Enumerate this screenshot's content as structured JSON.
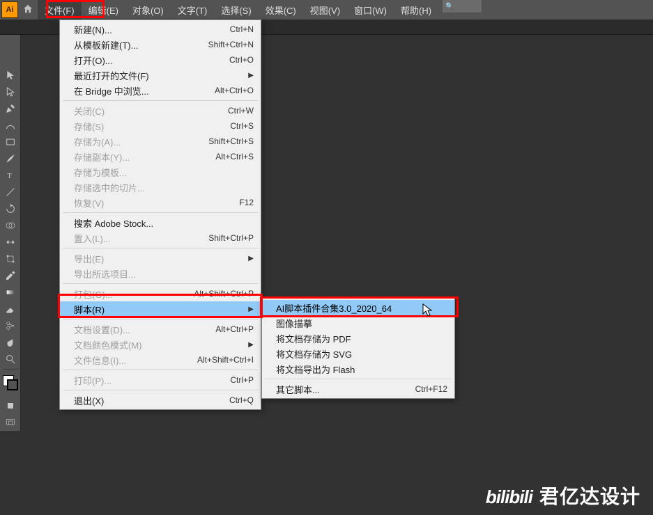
{
  "app": {
    "icon_text": "Ai",
    "search_placeholder": "搜索"
  },
  "menubar": [
    "文件(F)",
    "编辑(E)",
    "对象(O)",
    "文字(T)",
    "选择(S)",
    "效果(C)",
    "视图(V)",
    "窗口(W)",
    "帮助(H)"
  ],
  "file_menu": {
    "items": [
      {
        "label": "新建(N)...",
        "shortcut": "Ctrl+N"
      },
      {
        "label": "从模板新建(T)...",
        "shortcut": "Shift+Ctrl+N"
      },
      {
        "label": "打开(O)...",
        "shortcut": "Ctrl+O"
      },
      {
        "label": "最近打开的文件(F)",
        "arrow": true
      },
      {
        "label": "在 Bridge 中浏览...",
        "shortcut": "Alt+Ctrl+O"
      },
      {
        "sep": true
      },
      {
        "label": "关闭(C)",
        "shortcut": "Ctrl+W",
        "disabled": true
      },
      {
        "label": "存储(S)",
        "shortcut": "Ctrl+S",
        "disabled": true
      },
      {
        "label": "存储为(A)...",
        "shortcut": "Shift+Ctrl+S",
        "disabled": true
      },
      {
        "label": "存储副本(Y)...",
        "shortcut": "Alt+Ctrl+S",
        "disabled": true
      },
      {
        "label": "存储为模板...",
        "disabled": true
      },
      {
        "label": "存储选中的切片...",
        "disabled": true
      },
      {
        "label": "恢复(V)",
        "shortcut": "F12",
        "disabled": true
      },
      {
        "sep": true
      },
      {
        "label": "搜索 Adobe Stock..."
      },
      {
        "label": "置入(L)...",
        "shortcut": "Shift+Ctrl+P",
        "disabled": true
      },
      {
        "sep": true
      },
      {
        "label": "导出(E)",
        "arrow": true,
        "disabled": true
      },
      {
        "label": "导出所选项目...",
        "disabled": true
      },
      {
        "sep": true
      },
      {
        "label": "打包(G)...",
        "shortcut": "Alt+Shift+Ctrl+P",
        "disabled": true
      },
      {
        "label": "脚本(R)",
        "arrow": true,
        "highlight": true
      },
      {
        "sep": true
      },
      {
        "label": "文档设置(D)...",
        "shortcut": "Alt+Ctrl+P",
        "disabled": true
      },
      {
        "label": "文档颜色模式(M)",
        "arrow": true,
        "disabled": true
      },
      {
        "label": "文件信息(I)...",
        "shortcut": "Alt+Shift+Ctrl+I",
        "disabled": true
      },
      {
        "sep": true
      },
      {
        "label": "打印(P)...",
        "shortcut": "Ctrl+P",
        "disabled": true
      },
      {
        "sep": true
      },
      {
        "label": "退出(X)",
        "shortcut": "Ctrl+Q"
      }
    ]
  },
  "scripts_submenu": {
    "items": [
      {
        "label": "AI脚本插件合集3.0_2020_64",
        "highlight": true
      },
      {
        "label": "图像描摹",
        "disabled": true
      },
      {
        "label": "将文档存储为 PDF",
        "disabled": true
      },
      {
        "label": "将文档存储为 SVG",
        "disabled": true
      },
      {
        "label": "将文档导出为 Flash",
        "disabled": true
      },
      {
        "sep": true
      },
      {
        "label": "其它脚本...",
        "shortcut": "Ctrl+F12"
      }
    ]
  },
  "watermark": {
    "logo": "bilibili",
    "text": "君亿达设计"
  }
}
